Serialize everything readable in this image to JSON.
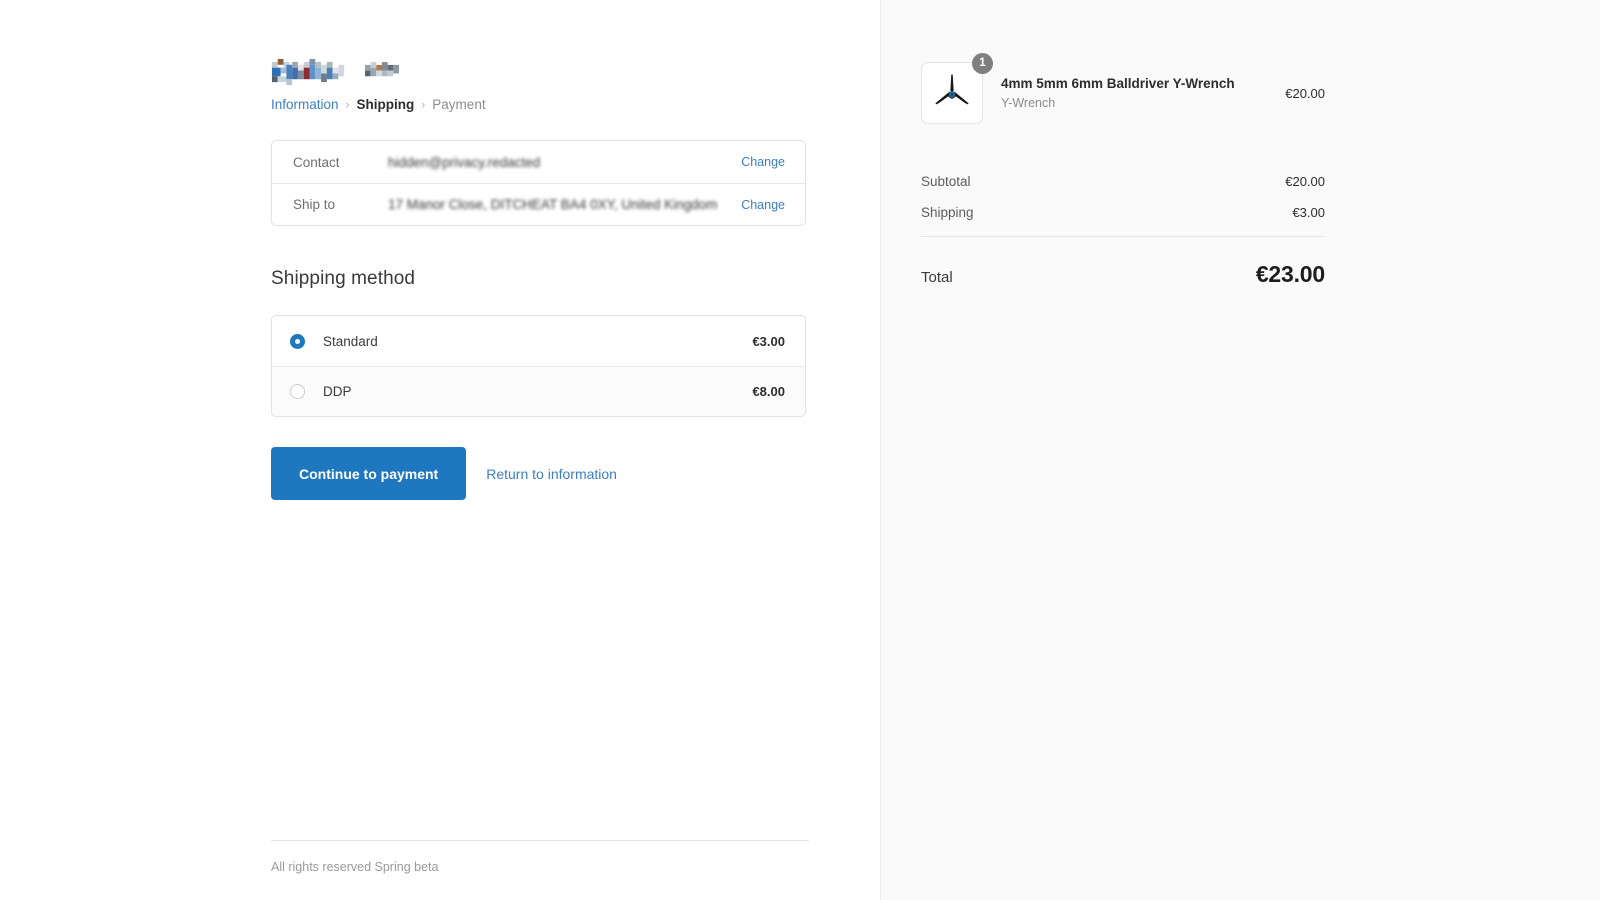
{
  "brand": {
    "logo_text": "Spring",
    "logo_suffix": "beta",
    "logo_state": "redacted-pixelated"
  },
  "breadcrumb": {
    "items": [
      {
        "label": "Information",
        "state": "link"
      },
      {
        "label": "Shipping",
        "state": "current"
      },
      {
        "label": "Payment",
        "state": "upcoming"
      }
    ],
    "separator": "›"
  },
  "review": {
    "rows": [
      {
        "label": "Contact",
        "value": "hidden@privacy.redacted",
        "redacted": true,
        "change_label": "Change"
      },
      {
        "label": "Ship to",
        "value": "17 Manor Close, DITCHEAT BA4 0XY, United Kingdom",
        "redacted": true,
        "change_label": "Change"
      }
    ]
  },
  "shipping": {
    "title": "Shipping method",
    "options": [
      {
        "name": "Standard",
        "price": "€3.00",
        "selected": true
      },
      {
        "name": "DDP",
        "price": "€8.00",
        "selected": false
      }
    ]
  },
  "actions": {
    "primary_label": "Continue to payment",
    "secondary_label": "Return to information"
  },
  "footer": {
    "text": "All rights reserved Spring beta"
  },
  "summary": {
    "item": {
      "quantity": "1",
      "title": "4mm 5mm 6mm Balldriver Y-Wrench",
      "variant": "Y-Wrench",
      "price": "€20.00",
      "image_name": "y-wrench-product-thumbnail"
    },
    "totals": [
      {
        "label": "Subtotal",
        "value": "€20.00"
      },
      {
        "label": "Shipping",
        "value": "€3.00"
      }
    ],
    "grand_total": {
      "label": "Total",
      "value": "€23.00"
    }
  },
  "colors": {
    "accent": "#1f78bf",
    "link": "#3b7fc4",
    "summary_bg": "#fafafa",
    "border": "#e2e2e2",
    "badge": "#7f7f7f"
  }
}
